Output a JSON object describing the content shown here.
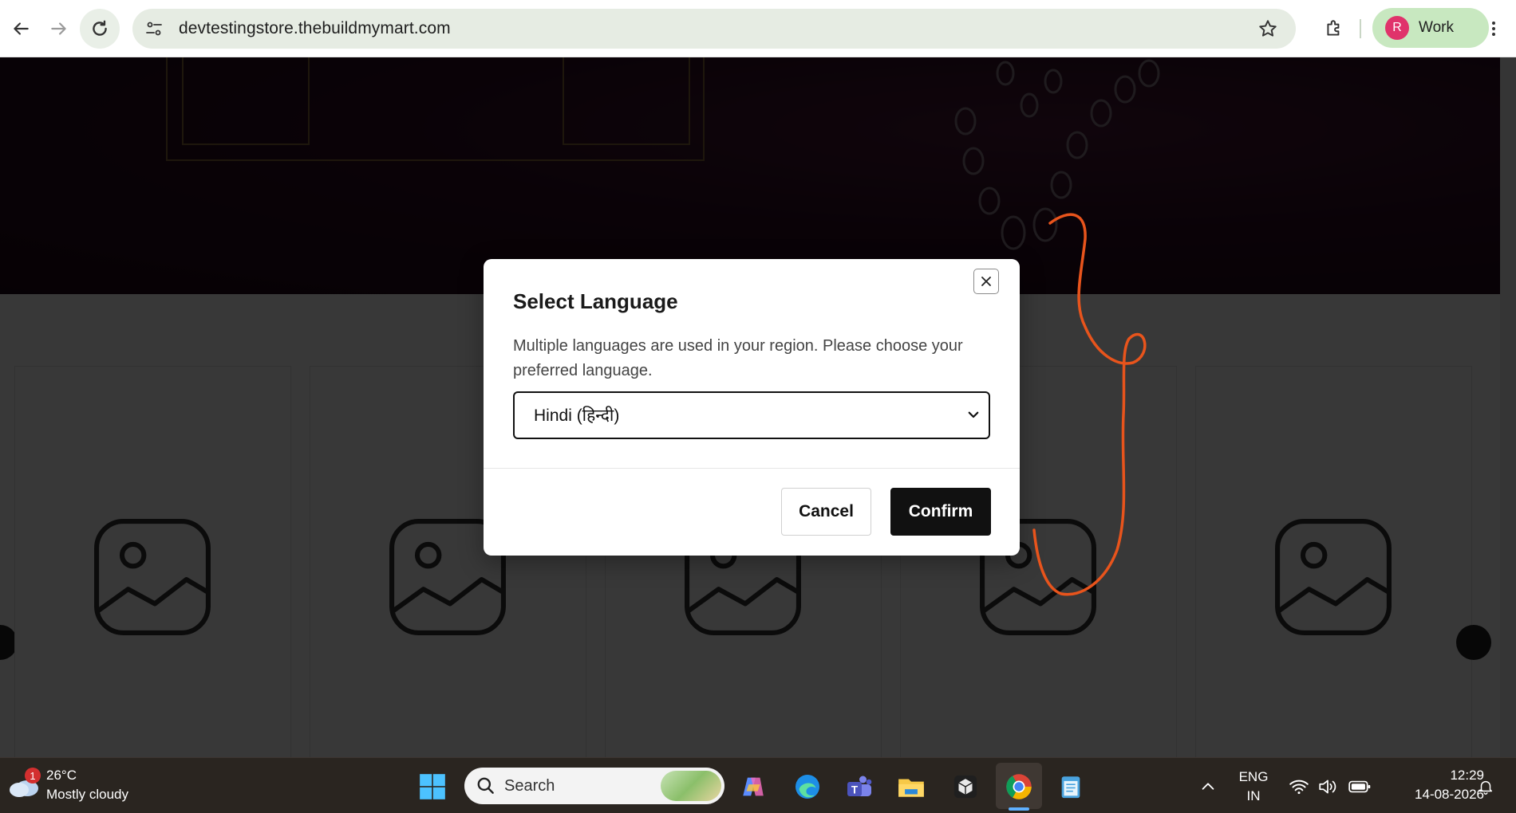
{
  "browser": {
    "url": "devtestingstore.thebuildmymart.com",
    "profile_initial": "R",
    "profile_label": "Work",
    "colors": {
      "profile_bg": "#c8e8c0",
      "avatar_bg": "#e0336b"
    }
  },
  "modal": {
    "title": "Select Language",
    "description": "Multiple languages are used in your region. Please choose your preferred language.",
    "selected_language": "Hindi (हिन्दी)",
    "cancel_label": "Cancel",
    "confirm_label": "Confirm",
    "close_icon": "close-icon"
  },
  "page": {
    "product_card_icons": [
      "image-placeholder-icon",
      "image-placeholder-icon",
      "image-placeholder-icon",
      "image-placeholder-icon",
      "image-placeholder-icon"
    ]
  },
  "taskbar": {
    "weather_badge": "1",
    "weather_temp": "26°C",
    "weather_desc": "Mostly cloudy",
    "search_label": "Search",
    "language_top": "ENG",
    "language_bottom": "IN",
    "time": "12:29",
    "date": "14-08-2026",
    "apps": [
      "windows-start-icon",
      "copilot-icon",
      "edge-icon",
      "teams-icon",
      "file-explorer-icon",
      "app-cube-icon",
      "chrome-icon",
      "notepad-icon"
    ]
  },
  "annotation_color": "#e8541c"
}
